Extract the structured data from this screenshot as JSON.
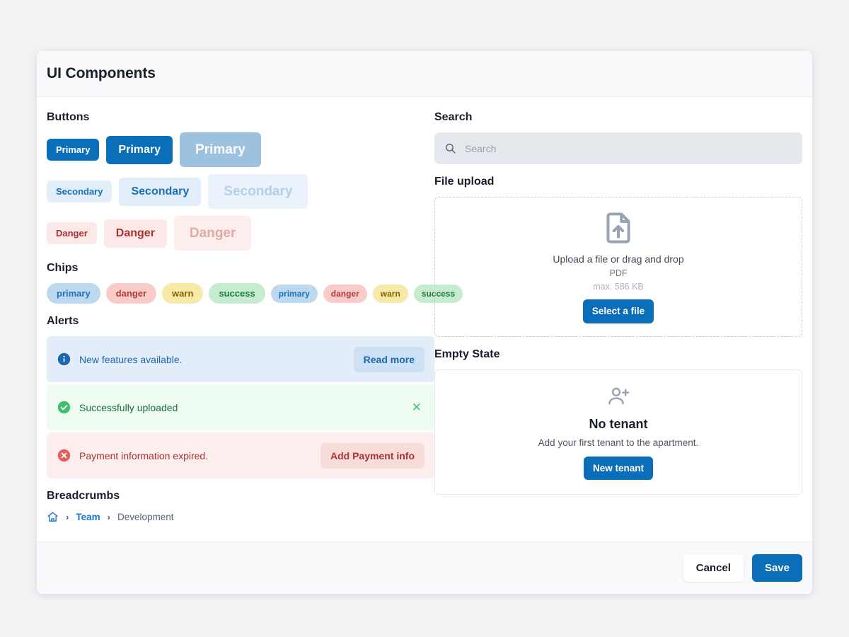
{
  "header": {
    "title": "UI Components"
  },
  "sections": {
    "buttons": "Buttons",
    "chips": "Chips",
    "alerts": "Alerts",
    "breadcrumbs": "Breadcrumbs",
    "search": "Search",
    "file_upload": "File upload",
    "empty_state": "Empty State"
  },
  "buttons": {
    "primary": [
      {
        "label": "Primary",
        "size": "sm",
        "state": "default"
      },
      {
        "label": "Primary",
        "size": "md",
        "state": "default"
      },
      {
        "label": "Primary",
        "size": "lg",
        "state": "disabled"
      }
    ],
    "secondary": [
      {
        "label": "Secondary",
        "size": "sm",
        "state": "default"
      },
      {
        "label": "Secondary",
        "size": "md",
        "state": "default"
      },
      {
        "label": "Secondary",
        "size": "lg",
        "state": "disabled"
      }
    ],
    "danger": [
      {
        "label": "Danger",
        "size": "sm",
        "state": "default"
      },
      {
        "label": "Danger",
        "size": "md",
        "state": "default"
      },
      {
        "label": "Danger",
        "size": "lg",
        "state": "disabled"
      }
    ]
  },
  "chips": [
    {
      "label": "primary",
      "variant": "primary",
      "size": "big"
    },
    {
      "label": "danger",
      "variant": "danger",
      "size": "big"
    },
    {
      "label": "warn",
      "variant": "warn",
      "size": "big"
    },
    {
      "label": "success",
      "variant": "success",
      "size": "big"
    },
    {
      "label": "primary",
      "variant": "primary",
      "size": "small"
    },
    {
      "label": "danger",
      "variant": "danger",
      "size": "small"
    },
    {
      "label": "warn",
      "variant": "warn",
      "size": "small"
    },
    {
      "label": "success",
      "variant": "success",
      "size": "small"
    }
  ],
  "alerts": [
    {
      "type": "info",
      "icon": "info-circle-icon",
      "message": "New features available.",
      "action_label": "Read more",
      "dismissible": false
    },
    {
      "type": "success",
      "icon": "check-circle-icon",
      "message": "Successfully uploaded",
      "action_label": null,
      "dismissible": true
    },
    {
      "type": "error",
      "icon": "error-circle-icon",
      "message": "Payment information expired.",
      "action_label": "Add Payment info",
      "dismissible": false
    }
  ],
  "breadcrumb": {
    "home_icon": "home-icon",
    "separator": "›",
    "items": [
      {
        "label": "Team",
        "current": false
      },
      {
        "label": "Development",
        "current": true
      }
    ]
  },
  "search": {
    "icon": "search-icon",
    "value": "",
    "placeholder": "Search"
  },
  "upload": {
    "icon": "file-upload-icon",
    "main_text": "Upload a file or drag and drop",
    "file_types": "PDF",
    "max_size": "max. 586 KB",
    "button_label": "Select a file"
  },
  "empty_state": {
    "icon": "person-add-icon",
    "title": "No tenant",
    "description": "Add your first tenant to the apartment.",
    "button_label": "New tenant"
  },
  "footer": {
    "cancel_label": "Cancel",
    "save_label": "Save"
  },
  "colors": {
    "primary": "#0b6eb8",
    "primary_disabled": "#9dc2e0",
    "secondary_bg": "#e3eefb",
    "secondary_text": "#1a6fb5",
    "danger_bg": "#fbe8e8",
    "danger_text": "#a93333",
    "info": "#1b68b0",
    "success": "#2fa75b",
    "error": "#e4605c",
    "warn_bg": "#f7e9a8",
    "page_bg": "#f1f2f4",
    "panel_bg": "#f8f9fb"
  }
}
